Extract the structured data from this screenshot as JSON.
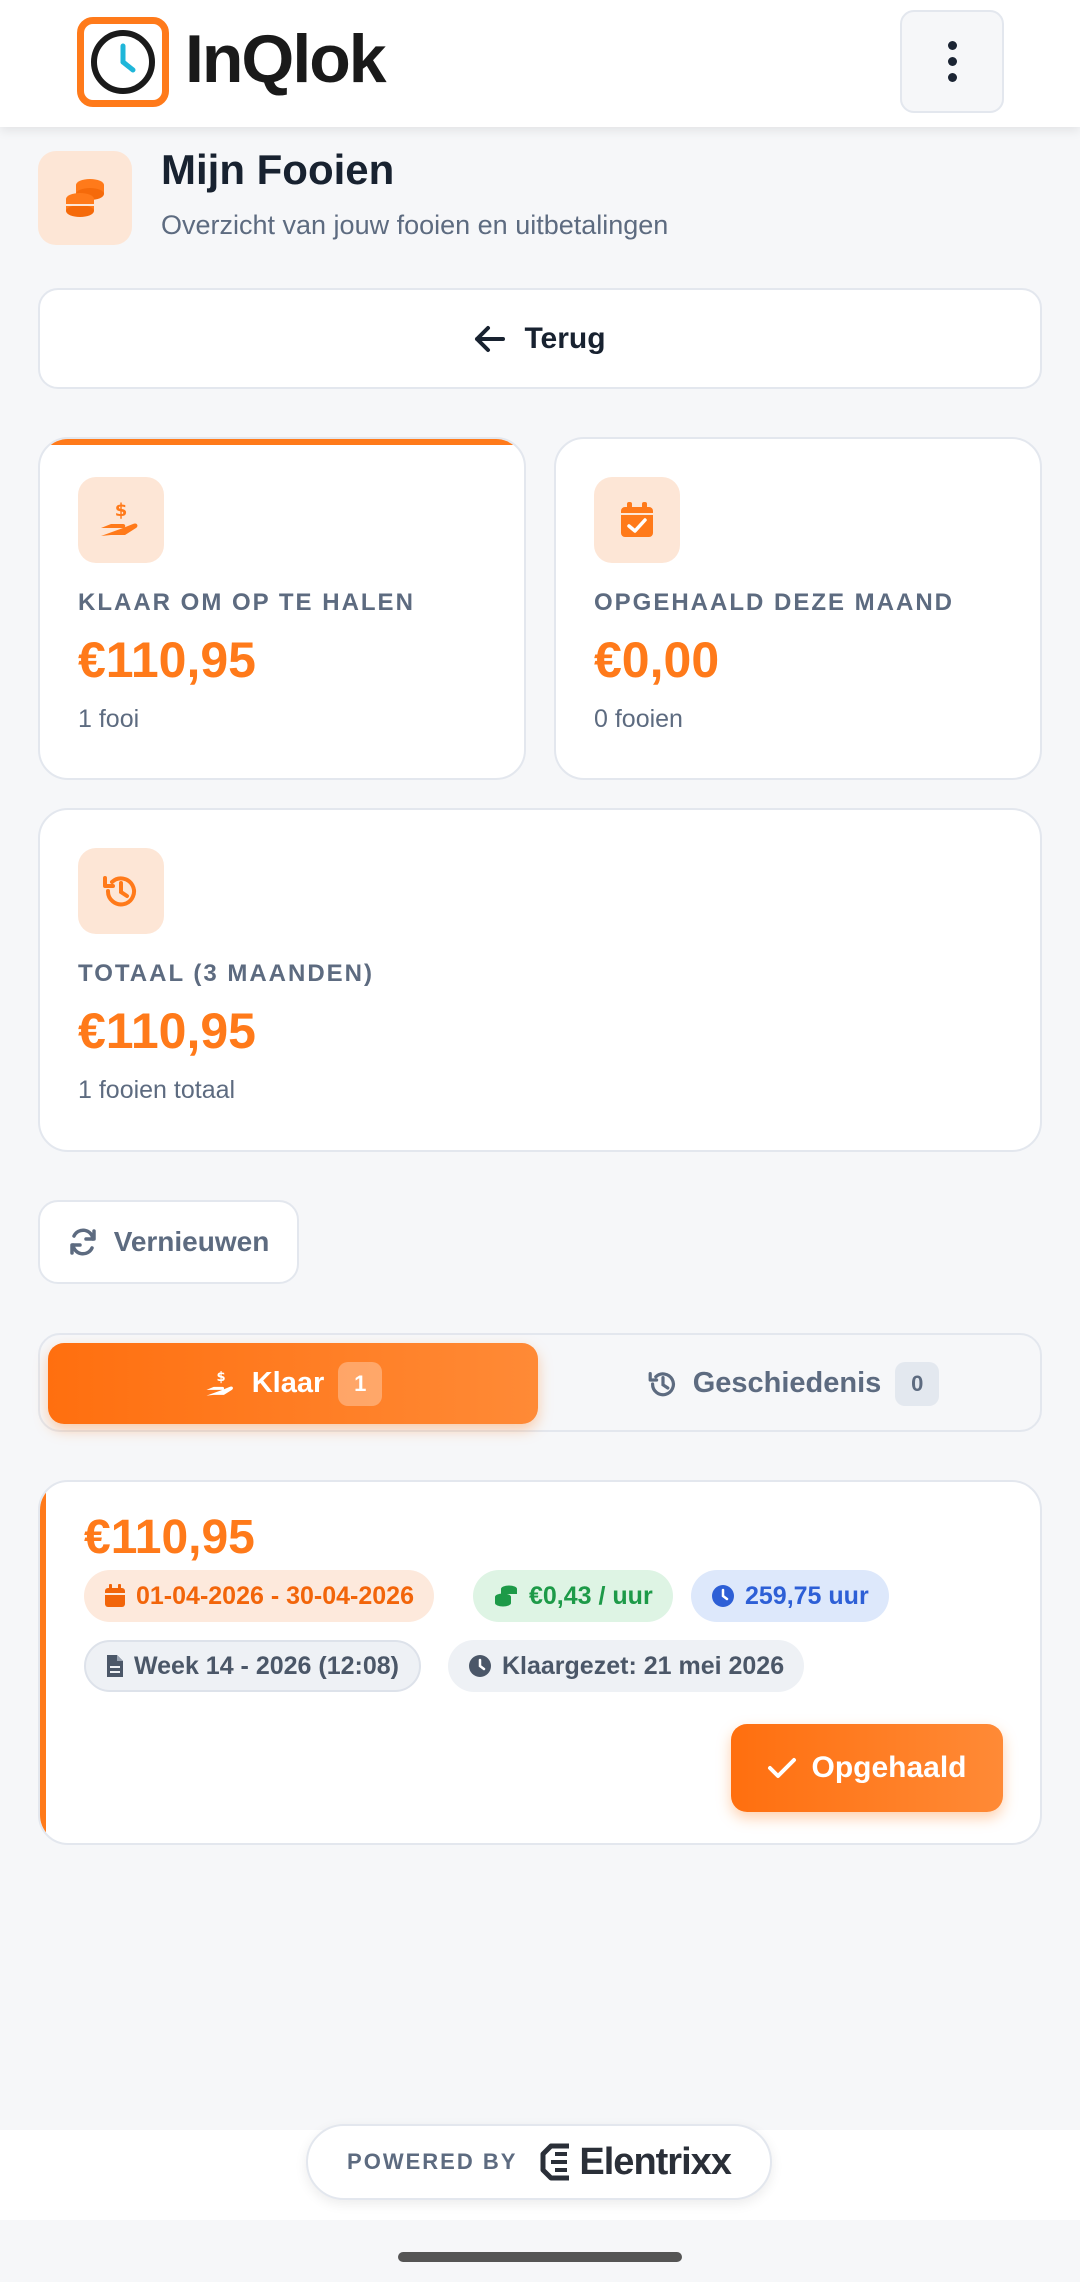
{
  "app": {
    "logo_text": "InQlok",
    "menu_icon": "kebab-icon"
  },
  "header": {
    "icon": "coins-icon",
    "title": "Mijn Fooien",
    "subtitle": "Overzicht van jouw fooien en uitbetalingen"
  },
  "back_button": {
    "icon": "arrow-left-icon",
    "label": "Terug"
  },
  "stats": {
    "ready": {
      "icon": "hand-dollar-icon",
      "label": "KLAAR OM OP TE HALEN",
      "amount": "€110,95",
      "sub": "1 fooi"
    },
    "month": {
      "icon": "calendar-check-icon",
      "label": "OPGEHAALD DEZE MAAND",
      "amount": "€0,00",
      "sub": "0 fooien"
    },
    "total": {
      "icon": "history-icon",
      "label": "TOTAAL (3 MAANDEN)",
      "amount": "€110,95",
      "sub": "1 fooien totaal"
    }
  },
  "refresh_button": {
    "icon": "refresh-icon",
    "label": "Vernieuwen"
  },
  "tabs": [
    {
      "icon": "hand-dollar-icon",
      "label": "Klaar",
      "count": "1",
      "active": true
    },
    {
      "icon": "history-icon",
      "label": "Geschiedenis",
      "count": "0",
      "active": false
    }
  ],
  "tip": {
    "amount": "€110,95",
    "period": "01-04-2026 - 30-04-2026",
    "per_hour": "€0,43 / uur",
    "hours": "259,75 uur",
    "week": "Week 14 - 2026 (12:08)",
    "ready_date": "Klaargezet: 21 mei 2026",
    "action_label": "Opgehaald"
  },
  "footer": {
    "powered_by": "POWERED BY",
    "brand": "Elentrixx"
  },
  "colors": {
    "accent": "#ff7a1a",
    "accent_light": "#fde6d6",
    "text_muted": "#5d6b80"
  }
}
